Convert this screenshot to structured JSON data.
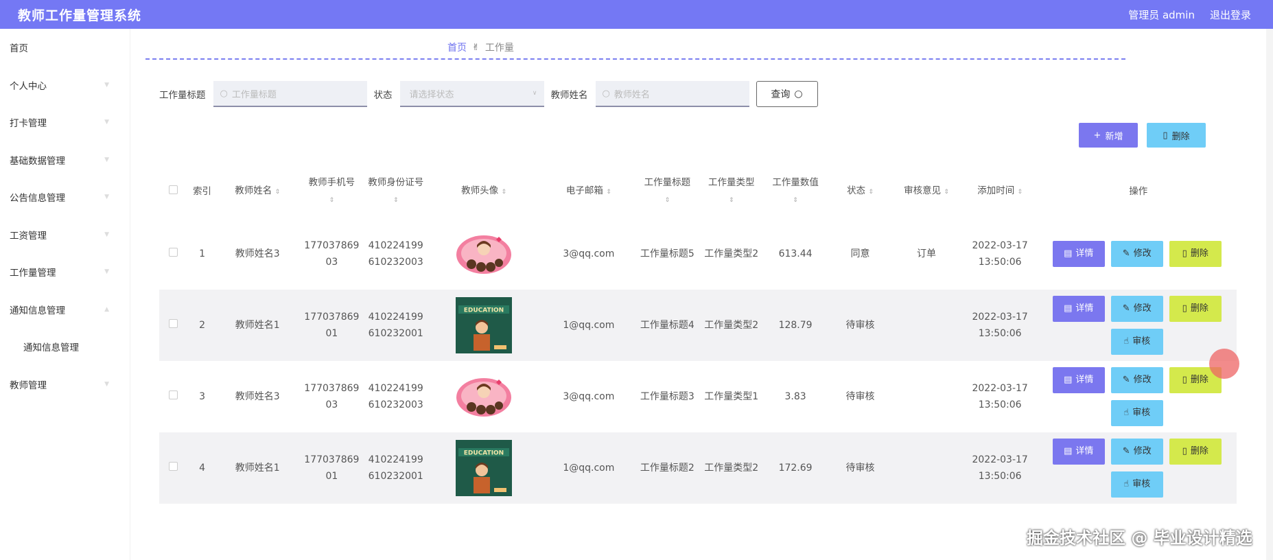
{
  "app": {
    "title": "教师工作量管理系统",
    "user": "管理员 admin",
    "logout": "退出登录"
  },
  "sidebar": {
    "items": [
      {
        "label": "首页"
      },
      {
        "label": "个人中心"
      },
      {
        "label": "打卡管理"
      },
      {
        "label": "基础数据管理"
      },
      {
        "label": "公告信息管理"
      },
      {
        "label": "工资管理"
      },
      {
        "label": "工作量管理"
      },
      {
        "label": "通知信息管理"
      },
      {
        "label": "通知信息管理"
      },
      {
        "label": "教师管理"
      }
    ]
  },
  "breadcrumb": {
    "home": "首页",
    "current": "工作量"
  },
  "search": {
    "title_label": "工作量标题",
    "title_placeholder": "工作量标题",
    "status_label": "状态",
    "status_placeholder": "请选择状态",
    "name_label": "教师姓名",
    "name_placeholder": "教师姓名",
    "query_button": "查询"
  },
  "actions": {
    "add": "新增",
    "delete": "删除"
  },
  "table": {
    "headers": [
      "索引",
      "教师姓名",
      "教师手机号",
      "教师身份证号",
      "教师头像",
      "电子邮箱",
      "工作量标题",
      "工作量类型",
      "工作量数值",
      "状态",
      "审核意见",
      "添加时间",
      "操作"
    ],
    "rows": [
      {
        "index": "1",
        "name": "教师姓名3",
        "phone1": "177037869",
        "phone2": "03",
        "id1": "410224199",
        "id2": "610232003",
        "avatar": "cartoon-girl",
        "email": "3@qq.com",
        "title": "工作量标题5",
        "type": "工作量类型2",
        "value": "613.44",
        "status": "同意",
        "opinion": "订单",
        "date": "2022-03-17",
        "time": "13:50:06",
        "audit": false
      },
      {
        "index": "2",
        "name": "教师姓名1",
        "phone1": "177037869",
        "phone2": "01",
        "id1": "410224199",
        "id2": "610232001",
        "avatar": "education-teacher",
        "email": "1@qq.com",
        "title": "工作量标题4",
        "type": "工作量类型2",
        "value": "128.79",
        "status": "待审核",
        "opinion": "",
        "date": "2022-03-17",
        "time": "13:50:06",
        "audit": true
      },
      {
        "index": "3",
        "name": "教师姓名3",
        "phone1": "177037869",
        "phone2": "03",
        "id1": "410224199",
        "id2": "610232003",
        "avatar": "cartoon-girl",
        "email": "3@qq.com",
        "title": "工作量标题3",
        "type": "工作量类型1",
        "value": "3.83",
        "status": "待审核",
        "opinion": "",
        "date": "2022-03-17",
        "time": "13:50:06",
        "audit": true
      },
      {
        "index": "4",
        "name": "教师姓名1",
        "phone1": "177037869",
        "phone2": "01",
        "id1": "410224199",
        "id2": "610232001",
        "avatar": "education-teacher",
        "email": "1@qq.com",
        "title": "工作量标题2",
        "type": "工作量类型2",
        "value": "172.69",
        "status": "待审核",
        "opinion": "",
        "date": "2022-03-17",
        "time": "13:50:06",
        "audit": true
      }
    ],
    "ops": {
      "detail": "详情",
      "edit": "修改",
      "delete": "删除",
      "audit": "审核"
    }
  },
  "watermark": "掘金技术社区 @ 毕业设计精选",
  "colors": {
    "topbar": "#7478f4",
    "detail": "#7b77ef",
    "edit": "#6fcdf7",
    "delete": "#d4e94c"
  }
}
